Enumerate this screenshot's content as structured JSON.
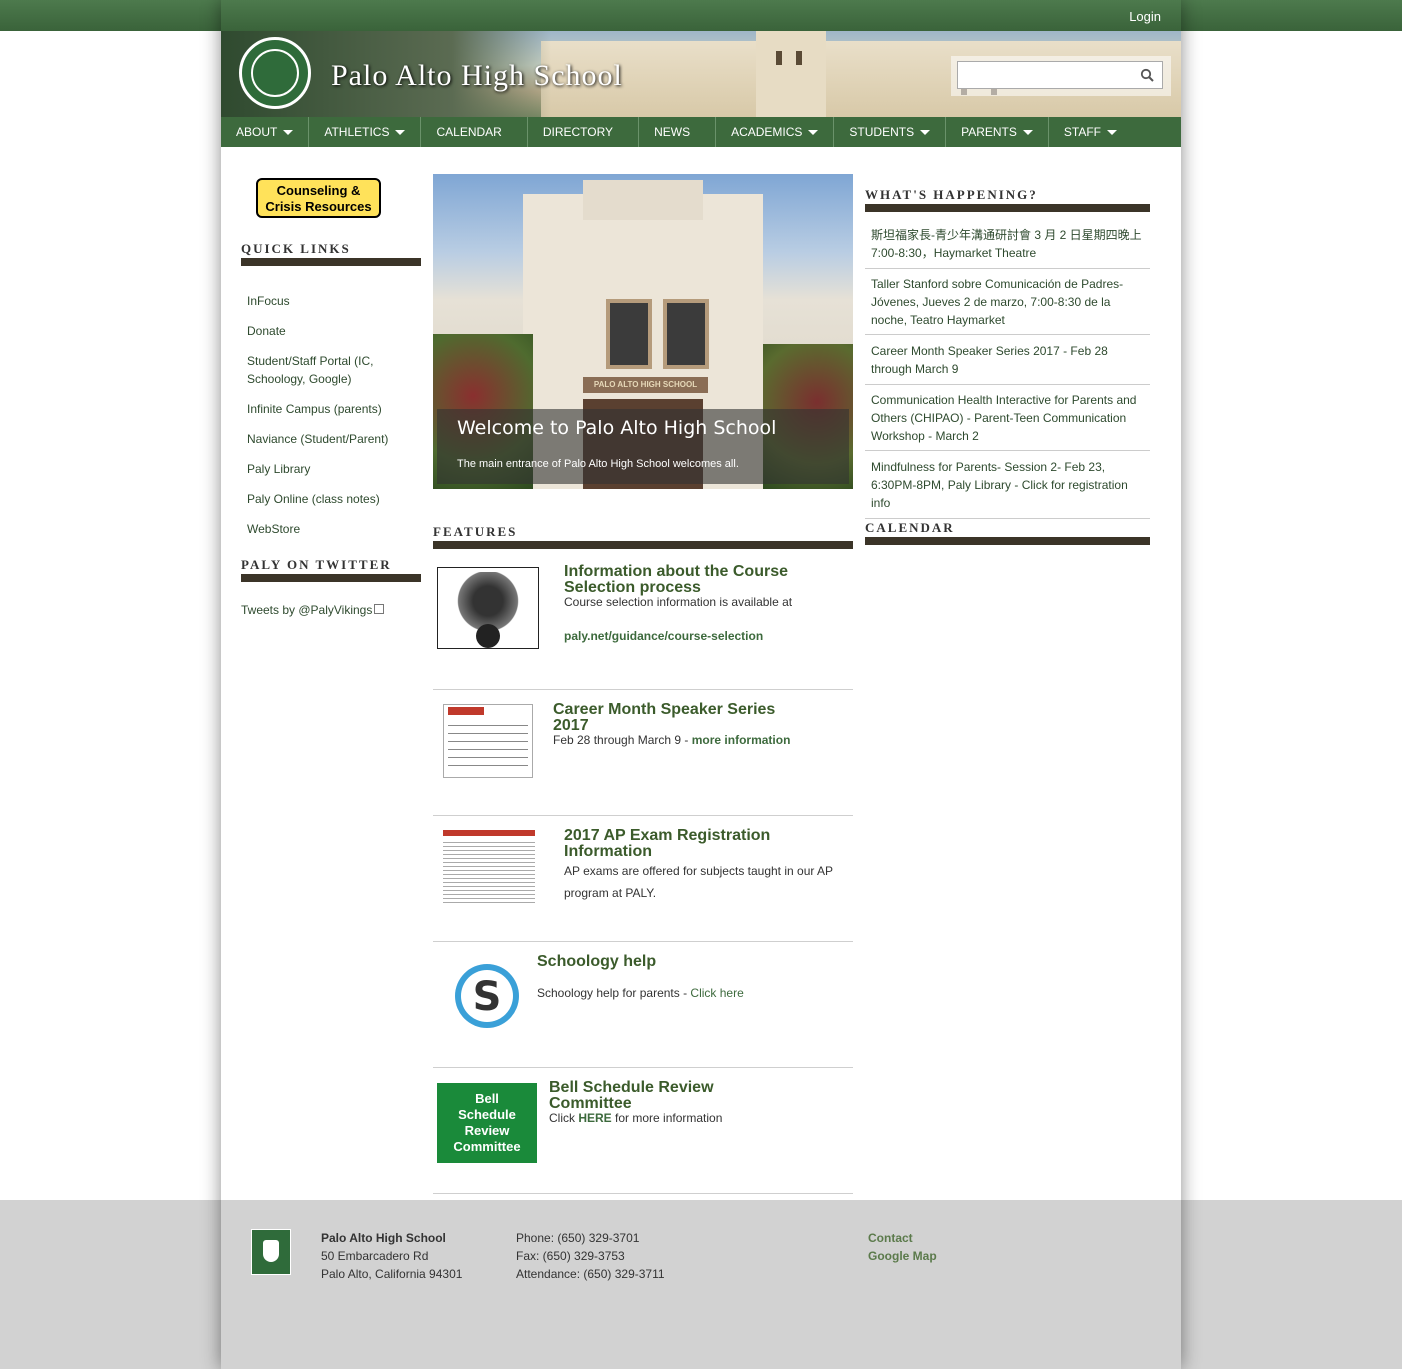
{
  "top_bar": {
    "login_label": "Login"
  },
  "header": {
    "site_title": "Palo Alto High School",
    "search_placeholder": ""
  },
  "nav": [
    {
      "label": "ABOUT",
      "has_submenu": true
    },
    {
      "label": "ATHLETICS",
      "has_submenu": true
    },
    {
      "label": "CALENDAR",
      "has_submenu": false
    },
    {
      "label": "DIRECTORY",
      "has_submenu": false
    },
    {
      "label": "NEWS",
      "has_submenu": false
    },
    {
      "label": "ACADEMICS",
      "has_submenu": true
    },
    {
      "label": "STUDENTS",
      "has_submenu": true
    },
    {
      "label": "PARENTS",
      "has_submenu": true
    },
    {
      "label": "STAFF",
      "has_submenu": true
    }
  ],
  "sidebar": {
    "counseling_button": "Counseling & Crisis Resources",
    "quick_links_heading": "QUICK LINKS",
    "quick_links": [
      "InFocus",
      "Donate",
      "Student/Staff Portal (IC, Schoology, Google)",
      "Infinite Campus (parents)",
      "Naviance (Student/Parent)",
      "Paly Library",
      "Paly Online (class notes)",
      "WebStore"
    ],
    "twitter_heading": "PALY ON TWITTER",
    "tweets_link": "Tweets by @PalyVikings"
  },
  "slider": {
    "caption_title": "Welcome to Palo Alto High School",
    "caption_text": "The main entrance of Palo Alto High School welcomes all.",
    "sign_text": "PALO ALTO HIGH SCHOOL"
  },
  "features": {
    "heading": "FEATURES",
    "items": [
      {
        "title": "Information about the Course Selection process",
        "text": "Course selection information is available at",
        "link": "paly.net/guidance/course-selection"
      },
      {
        "title": "Career Month Speaker Series 2017",
        "text": "Feb 28 through March 9 - ",
        "link": "more information"
      },
      {
        "title": "2017 AP Exam Registration Information",
        "text": "AP exams are offered for subjects taught in our AP program at PALY."
      },
      {
        "title": "Schoology help",
        "text": "Schoology help for parents - ",
        "link": "Click here"
      },
      {
        "title": "Bell Schedule Review Committee",
        "text_before": "Click ",
        "link": "HERE",
        "text_after": " for more information",
        "thumb_text": "Bell Schedule Review Committee"
      }
    ]
  },
  "whats_happening": {
    "heading": "WHAT'S HAPPENING?",
    "items": [
      "斯坦福家長-青少年溝通研討會 3 月 2 日星期四晚上 7:00-8:30，Haymarket Theatre",
      "Taller Stanford sobre Comunicación de Padres-Jóvenes, Jueves 2 de marzo, 7:00-8:30 de la noche, Teatro Haymarket",
      "Career Month Speaker Series 2017 - Feb 28 through March 9",
      "Communication Health Interactive for Parents and Others (CHIPAO) - Parent-Teen Communication Workshop - March 2",
      "Mindfulness for Parents- Session 2- Feb 23, 6:30PM-8PM, Paly Library - Click for registration info"
    ],
    "calendar_heading": "CALENDAR"
  },
  "footer": {
    "school_name": "Palo Alto High School",
    "address_line1": "50 Embarcadero Rd",
    "address_line2": "Palo Alto, California 94301",
    "phone": "Phone: (650) 329-3701",
    "fax": "Fax: (650) 329-3753",
    "attendance": "Attendance: (650) 329-3711",
    "links": [
      "Contact",
      "Google Map"
    ]
  },
  "colors": {
    "brand_green": "#3d6a3d",
    "dark_bar": "#3b3428",
    "counsel_yellow": "#ffe25a"
  }
}
